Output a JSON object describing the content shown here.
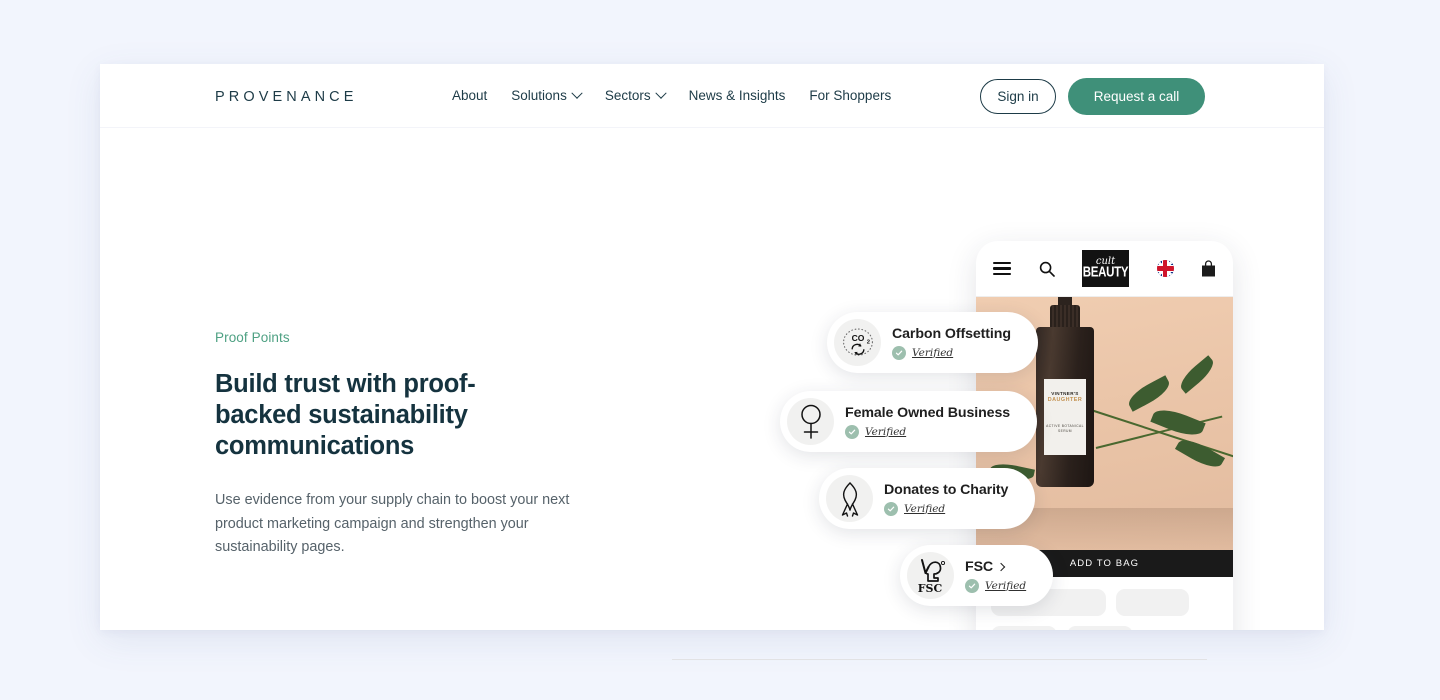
{
  "header": {
    "brand": "PROVENANCE",
    "nav": [
      {
        "label": "About",
        "has_dropdown": false
      },
      {
        "label": "Solutions",
        "has_dropdown": true
      },
      {
        "label": "Sectors",
        "has_dropdown": true
      },
      {
        "label": "News & Insights",
        "has_dropdown": false
      },
      {
        "label": "For Shoppers",
        "has_dropdown": false
      }
    ],
    "sign_in_label": "Sign in",
    "request_call_label": "Request a call"
  },
  "hero": {
    "eyebrow": "Proof Points",
    "title": "Build trust with proof-backed sustainability communications",
    "subtitle": "Use evidence from your supply chain to boost your next product marketing campaign and strengthen your sustainability pages."
  },
  "mockup": {
    "store_logo_top": "cult",
    "store_logo_bottom": "BEAUTY",
    "icons": [
      "hamburger-menu-icon",
      "search-icon",
      "uk-flag-icon",
      "shopping-bag-icon"
    ],
    "product": {
      "brand_line_1": "VINTNER'S",
      "brand_line_2": "DAUGHTER",
      "description": "ACTIVE BOTANICAL SERUM"
    },
    "add_to_bag_label": "ADD TO BAG"
  },
  "proof_points": [
    {
      "title": "Carbon Offsetting",
      "status": "Verified",
      "icon": "carbon-offsetting-icon",
      "chevron": false
    },
    {
      "title": "Female Owned Business",
      "status": "Verified",
      "icon": "female-symbol-icon",
      "chevron": false
    },
    {
      "title": "Donates to Charity",
      "status": "Verified",
      "icon": "charity-ribbon-icon",
      "chevron": false
    },
    {
      "title": "FSC",
      "status": "Verified",
      "icon": "fsc-logo-icon",
      "chevron": true
    }
  ],
  "colors": {
    "page_background": "#f2f5fd",
    "brand_dark": "#1d3b47",
    "accent_green": "#3f9079",
    "eyebrow_green": "#4ea183",
    "verified_badge": "#9dbfae",
    "body_text": "#56626a"
  }
}
